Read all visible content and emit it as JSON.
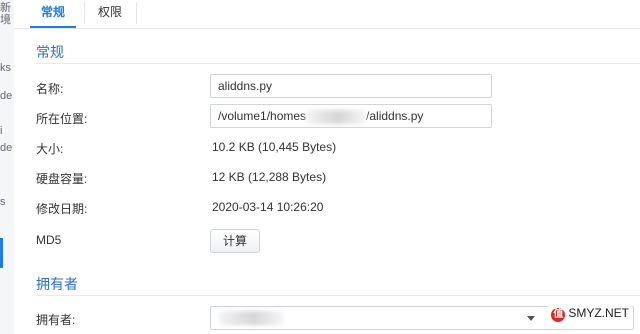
{
  "background": {
    "fragments": [
      "新境",
      "ks",
      "de",
      "i",
      "de",
      "s"
    ]
  },
  "tabs": [
    {
      "label": "常规",
      "active": true
    },
    {
      "label": "权限",
      "active": false
    }
  ],
  "general": {
    "section_title": "常规",
    "name_label": "名称:",
    "name_value": "aliddns.py",
    "location_label": "所在位置:",
    "location_prefix": "/volume1/homes",
    "location_suffix": "/aliddns.py",
    "size_label": "大小:",
    "size_value": "10.2 KB (10,445 Bytes)",
    "disk_label": "硬盘容量:",
    "disk_value": "12 KB (12,288 Bytes)",
    "modified_label": "修改日期:",
    "modified_value": "2020-03-14 10:26:20",
    "md5_label": "MD5",
    "md5_button": "计算"
  },
  "owner": {
    "section_title": "拥有者",
    "owner_label": "拥有者:"
  },
  "watermark": {
    "badge": "值",
    "text": "SMYZ.NET"
  }
}
